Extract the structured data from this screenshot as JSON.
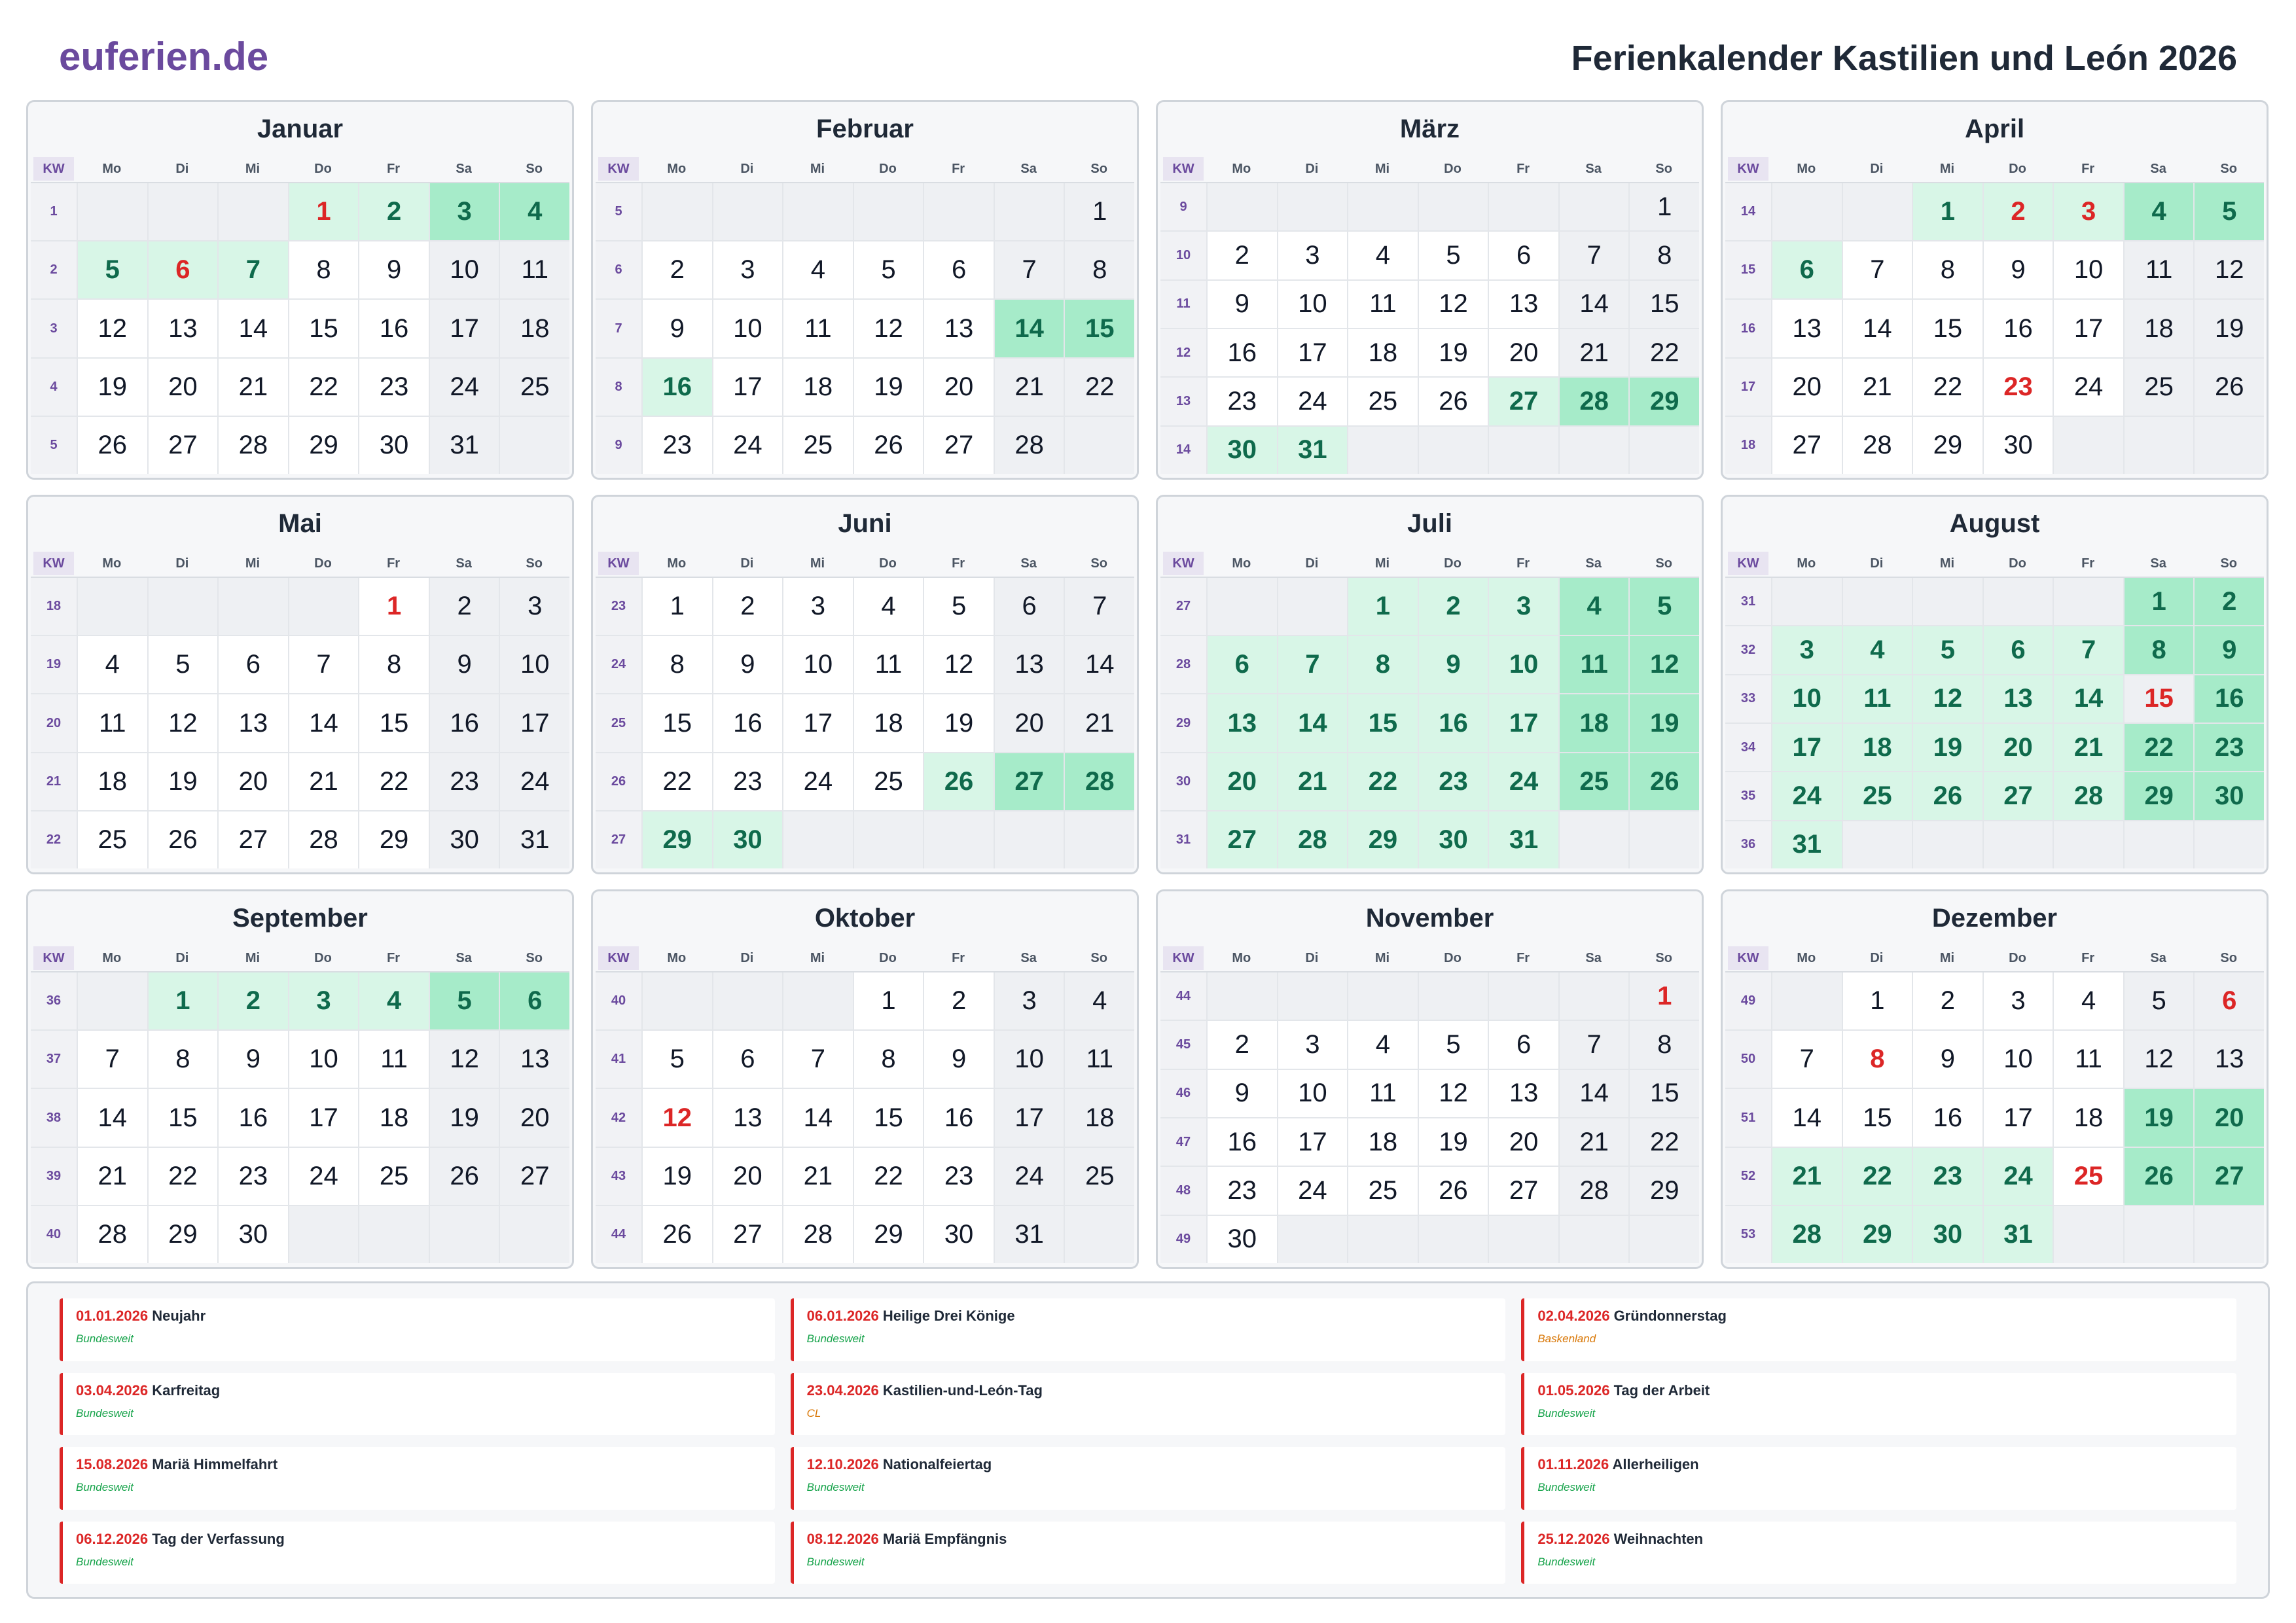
{
  "header": {
    "logo": "euferien.de",
    "title": "Ferienkalender Kastilien und León 2026"
  },
  "weekday_labels": [
    "KW",
    "Mo",
    "Di",
    "Mi",
    "Do",
    "Fr",
    "Sa",
    "So"
  ],
  "months": [
    {
      "name": "Januar",
      "first_weekday": 3,
      "days": 31,
      "first_kw": 1,
      "holidays": [
        1,
        6
      ],
      "vacation": [
        1,
        2,
        3,
        4,
        5,
        6,
        7
      ]
    },
    {
      "name": "Februar",
      "first_weekday": 6,
      "days": 28,
      "first_kw": 5,
      "holidays": [],
      "vacation": [
        14,
        15,
        16
      ]
    },
    {
      "name": "März",
      "first_weekday": 6,
      "days": 31,
      "first_kw": 9,
      "holidays": [],
      "vacation": [
        27,
        28,
        29,
        30,
        31
      ]
    },
    {
      "name": "April",
      "first_weekday": 2,
      "days": 30,
      "first_kw": 14,
      "holidays": [
        2,
        3,
        23
      ],
      "vacation": [
        1,
        2,
        3,
        4,
        5,
        6
      ]
    },
    {
      "name": "Mai",
      "first_weekday": 4,
      "days": 31,
      "first_kw": 18,
      "holidays": [
        1
      ],
      "vacation": []
    },
    {
      "name": "Juni",
      "first_weekday": 0,
      "days": 30,
      "first_kw": 23,
      "holidays": [],
      "vacation": [
        26,
        27,
        28,
        29,
        30
      ]
    },
    {
      "name": "Juli",
      "first_weekday": 2,
      "days": 31,
      "first_kw": 27,
      "holidays": [],
      "vacation": [
        1,
        2,
        3,
        4,
        5,
        6,
        7,
        8,
        9,
        10,
        11,
        12,
        13,
        14,
        15,
        16,
        17,
        18,
        19,
        20,
        21,
        22,
        23,
        24,
        25,
        26,
        27,
        28,
        29,
        30,
        31
      ]
    },
    {
      "name": "August",
      "first_weekday": 5,
      "days": 31,
      "first_kw": 31,
      "holidays": [
        15
      ],
      "vacation": [
        1,
        2,
        3,
        4,
        5,
        6,
        7,
        8,
        9,
        10,
        11,
        12,
        13,
        14,
        16,
        17,
        18,
        19,
        20,
        21,
        22,
        23,
        24,
        25,
        26,
        27,
        28,
        29,
        30,
        31
      ]
    },
    {
      "name": "September",
      "first_weekday": 1,
      "days": 30,
      "first_kw": 36,
      "holidays": [],
      "vacation": [
        1,
        2,
        3,
        4,
        5,
        6
      ]
    },
    {
      "name": "Oktober",
      "first_weekday": 3,
      "days": 31,
      "first_kw": 40,
      "holidays": [
        12
      ],
      "vacation": []
    },
    {
      "name": "November",
      "first_weekday": 6,
      "days": 30,
      "first_kw": 44,
      "holidays": [
        1
      ],
      "vacation": []
    },
    {
      "name": "Dezember",
      "first_weekday": 1,
      "days": 31,
      "first_kw": 49,
      "holidays": [
        6,
        8,
        25
      ],
      "vacation": [
        19,
        20,
        21,
        22,
        23,
        24,
        26,
        27,
        28,
        29,
        30,
        31
      ]
    }
  ],
  "holidays_list": [
    {
      "date": "01.01.2026",
      "name": "Neujahr",
      "region": "Bundesweit",
      "national": true
    },
    {
      "date": "06.01.2026",
      "name": "Heilige Drei Könige",
      "region": "Bundesweit",
      "national": true
    },
    {
      "date": "02.04.2026",
      "name": "Gründonnerstag",
      "region": "Baskenland",
      "national": false
    },
    {
      "date": "03.04.2026",
      "name": "Karfreitag",
      "region": "Bundesweit",
      "national": true
    },
    {
      "date": "23.04.2026",
      "name": "Kastilien-und-León-Tag",
      "region": "CL",
      "national": false
    },
    {
      "date": "01.05.2026",
      "name": "Tag der Arbeit",
      "region": "Bundesweit",
      "national": true
    },
    {
      "date": "15.08.2026",
      "name": "Mariä Himmelfahrt",
      "region": "Bundesweit",
      "national": true
    },
    {
      "date": "12.10.2026",
      "name": "Nationalfeiertag",
      "region": "Bundesweit",
      "national": true
    },
    {
      "date": "01.11.2026",
      "name": "Allerheiligen",
      "region": "Bundesweit",
      "national": true
    },
    {
      "date": "06.12.2026",
      "name": "Tag der Verfassung",
      "region": "Bundesweit",
      "national": true
    },
    {
      "date": "08.12.2026",
      "name": "Mariä Empfängnis",
      "region": "Bundesweit",
      "national": true
    },
    {
      "date": "25.12.2026",
      "name": "Weihnachten",
      "region": "Bundesweit",
      "national": true
    }
  ],
  "colors": {
    "brand": "#6b4a9e",
    "holiday_red": "#dc2626",
    "vacation_weekday": "#d8f6e7",
    "vacation_weekend": "#a6ebc9",
    "vacation_text": "#0f6a4c",
    "region_national": "#16a34a",
    "region_regional": "#d97706"
  }
}
